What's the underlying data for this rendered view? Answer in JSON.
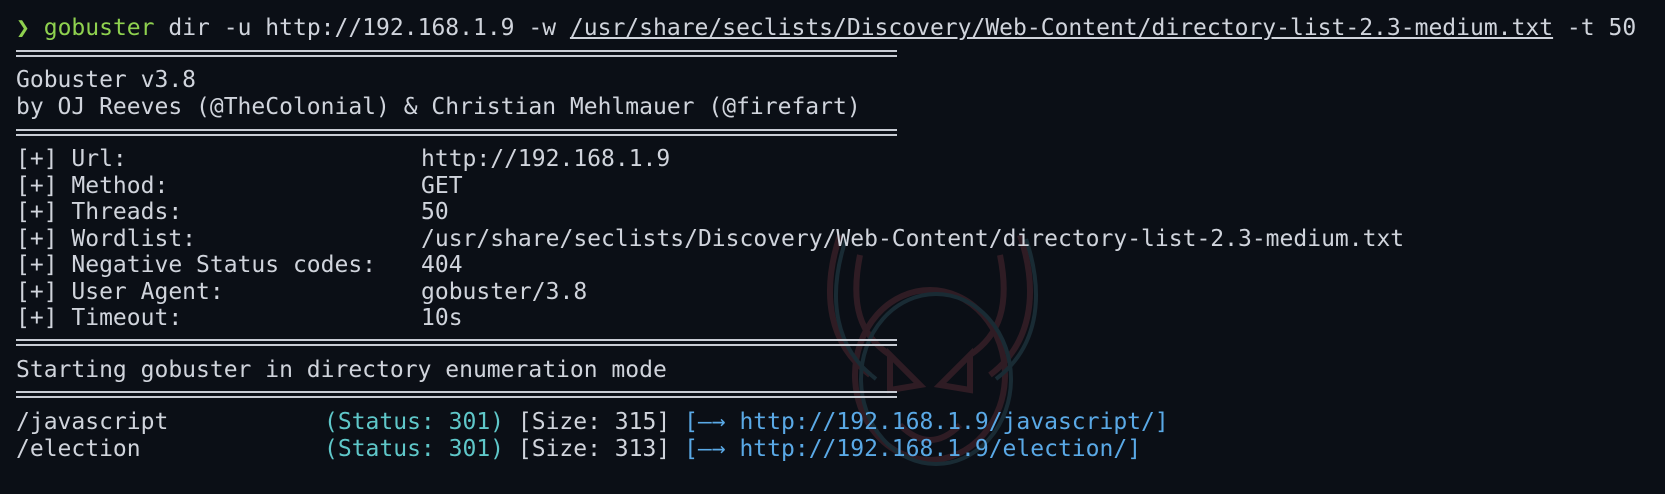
{
  "command": {
    "prompt_symbol": "❯",
    "program": "gobuster",
    "args_before": " dir -u http://192.168.1.9 -w ",
    "wordlist_path": "/usr/share/seclists/Discovery/Web-Content/directory-list-2.3-medium.txt",
    "args_after": " -t 50"
  },
  "banner": {
    "version_line": "Gobuster v3.8",
    "authors_line": "by OJ Reeves (@TheColonial) & Christian Mehlmauer (@firefart)"
  },
  "config": [
    {
      "label": "[+] Url:",
      "value": "http://192.168.1.9"
    },
    {
      "label": "[+] Method:",
      "value": "GET"
    },
    {
      "label": "[+] Threads:",
      "value": "50"
    },
    {
      "label": "[+] Wordlist:",
      "value": "/usr/share/seclists/Discovery/Web-Content/directory-list-2.3-medium.txt"
    },
    {
      "label": "[+] Negative Status codes:",
      "value": "404"
    },
    {
      "label": "[+] User Agent:",
      "value": "gobuster/3.8"
    },
    {
      "label": "[+] Timeout:",
      "value": "10s"
    }
  ],
  "start_message": "Starting gobuster in directory enumeration mode",
  "results": [
    {
      "path": "/javascript",
      "status": "(Status: 301)",
      "size": "[Size: 315]",
      "arrow_open": "[—→ ",
      "url": "http://192.168.1.9/javascript/",
      "arrow_close": "]"
    },
    {
      "path": "/election",
      "status": "(Status: 301)",
      "size": "[Size: 313]",
      "arrow_open": "[—→ ",
      "url": "http://192.168.1.9/election/",
      "arrow_close": "]"
    }
  ],
  "colors": {
    "background": "#0b0f16",
    "text": "#d0d4dc",
    "prompt_green": "#8fd14f",
    "status_cyan": "#5fc7c9",
    "link_blue": "#5aa9e6"
  }
}
